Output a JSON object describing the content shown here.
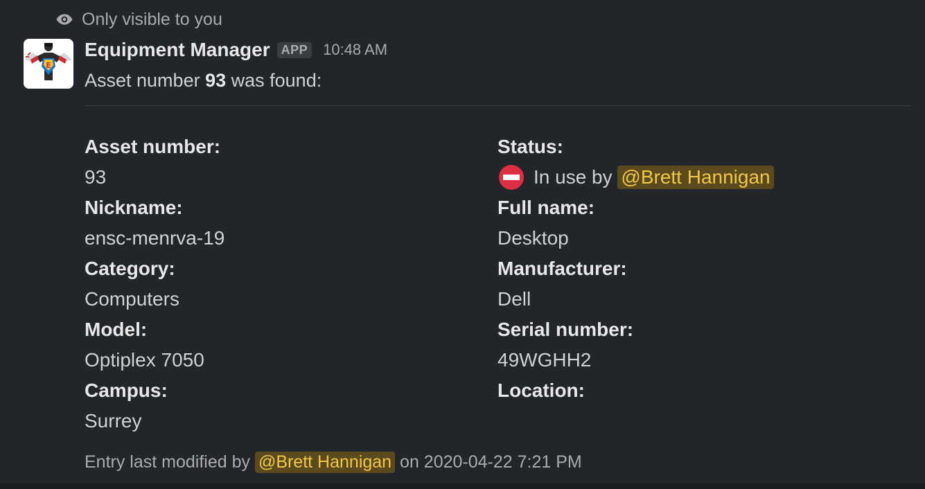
{
  "visibility": {
    "icon": "eye-icon",
    "text": "Only visible to you"
  },
  "message": {
    "sender": "Equipment Manager",
    "badge": "APP",
    "time": "10:48 AM",
    "text_prefix": "Asset number ",
    "asset_number": "93",
    "text_suffix": " was found:"
  },
  "fields_left": [
    {
      "label": "Asset number:",
      "value": "93"
    },
    {
      "label": "Nickname:",
      "value": "ensc-menrva-19"
    },
    {
      "label": "Category:",
      "value": "Computers"
    },
    {
      "label": "Model:",
      "value": "Optiplex 7050"
    },
    {
      "label": "Campus:",
      "value": "Surrey"
    }
  ],
  "fields_right": {
    "status_label": "Status:",
    "status_icon": "no-entry-icon",
    "status_text": "In use by ",
    "status_mention": "@Brett Hannigan",
    "full_name_label": "Full name:",
    "full_name_value": "Desktop",
    "manufacturer_label": "Manufacturer:",
    "manufacturer_value": "Dell",
    "serial_label": "Serial number:",
    "serial_value": "49WGHH2",
    "location_label": "Location:"
  },
  "footer": {
    "prefix": "Entry last modified by ",
    "mention": "@Brett Hannigan",
    "suffix": " on 2020-04-22 7:21 PM"
  },
  "colors": {
    "background": "#222529",
    "mention_bg": "#5c4a1f",
    "mention_text": "#f2c744",
    "status_red": "#dd2e44"
  }
}
